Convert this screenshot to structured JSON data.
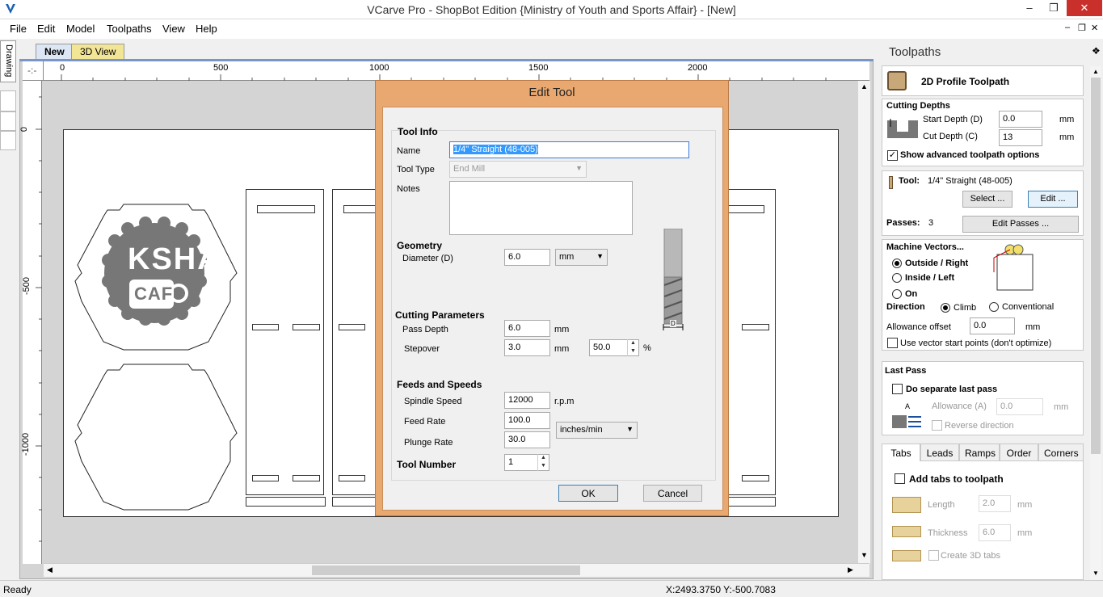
{
  "window": {
    "title": "VCarve Pro - ShopBot Edition {Ministry of Youth and Sports Affair} - [New]"
  },
  "menu": [
    "File",
    "Edit",
    "Model",
    "Toolpaths",
    "View",
    "Help"
  ],
  "side_tab": "Drawing",
  "doc_tabs": {
    "new": "New",
    "view3d": "3D View"
  },
  "ruler": {
    "h_ticks": [
      "0",
      "500",
      "1000",
      "1500",
      "2000"
    ],
    "v_ticks": [
      "0",
      "-500",
      "-1000"
    ]
  },
  "artwork": {
    "logo_line1": "KSHA",
    "logo_line2": "CAFe"
  },
  "dialog": {
    "title": "Edit Tool",
    "tool_info": {
      "heading": "Tool Info",
      "name_label": "Name",
      "name_value": "1/4\" Straight  (48-005)",
      "type_label": "Tool Type",
      "type_value": "End Mill",
      "notes_label": "Notes"
    },
    "geometry": {
      "heading": "Geometry",
      "diameter_label": "Diameter (D)",
      "diameter_value": "6.0",
      "unit": "mm"
    },
    "cutting": {
      "heading": "Cutting Parameters",
      "pass_depth_label": "Pass Depth",
      "pass_depth_value": "6.0",
      "pass_depth_unit": "mm",
      "stepover_label": "Stepover",
      "stepover_value": "3.0",
      "stepover_unit": "mm",
      "stepover_pct": "50.0",
      "pct": "%"
    },
    "feeds": {
      "heading": "Feeds and Speeds",
      "spindle_label": "Spindle Speed",
      "spindle_value": "12000",
      "spindle_unit": "r.p.m",
      "feed_label": "Feed Rate",
      "feed_value": "100.0",
      "plunge_label": "Plunge Rate",
      "plunge_value": "30.0",
      "rate_unit": "inches/min"
    },
    "tool_number": {
      "label": "Tool Number",
      "value": "1"
    },
    "diagram_label": "D",
    "ok": "OK",
    "cancel": "Cancel"
  },
  "toolpaths": {
    "header": "Toolpaths",
    "type": "2D Profile Toolpath",
    "depths": {
      "heading": "Cutting Depths",
      "start_label": "Start Depth (D)",
      "start_value": "0.0",
      "cut_label": "Cut Depth (C)",
      "cut_value": "13",
      "unit": "mm",
      "advanced": "Show advanced toolpath options"
    },
    "tool": {
      "label": "Tool:",
      "value": "1/4\" Straight  (48-005)",
      "select": "Select ...",
      "edit": "Edit ...",
      "passes_label": "Passes:",
      "passes_value": "3",
      "edit_passes": "Edit Passes ..."
    },
    "vectors": {
      "heading": "Machine Vectors...",
      "outside": "Outside / Right",
      "inside": "Inside / Left",
      "on": "On",
      "direction": "Direction",
      "climb": "Climb",
      "conventional": "Conventional",
      "allowance_label": "Allowance offset",
      "allowance_value": "0.0",
      "unit": "mm",
      "start_points": "Use vector start points (don't optimize)"
    },
    "last_pass": {
      "heading": "Last Pass",
      "separate": "Do separate last pass",
      "allowance_label": "Allowance (A)",
      "allowance_value": "0.0",
      "unit": "mm",
      "reverse": "Reverse direction"
    },
    "tabs": [
      "Tabs",
      "Leads",
      "Ramps",
      "Order",
      "Corners"
    ],
    "tabs_panel": {
      "add": "Add tabs to toolpath",
      "length_label": "Length",
      "length_value": "2.0",
      "thickness_label": "Thickness",
      "thickness_value": "6.0",
      "unit": "mm",
      "create3d": "Create 3D tabs"
    }
  },
  "status": {
    "left": "Ready",
    "coords": "X:2493.3750 Y:-500.7083"
  }
}
